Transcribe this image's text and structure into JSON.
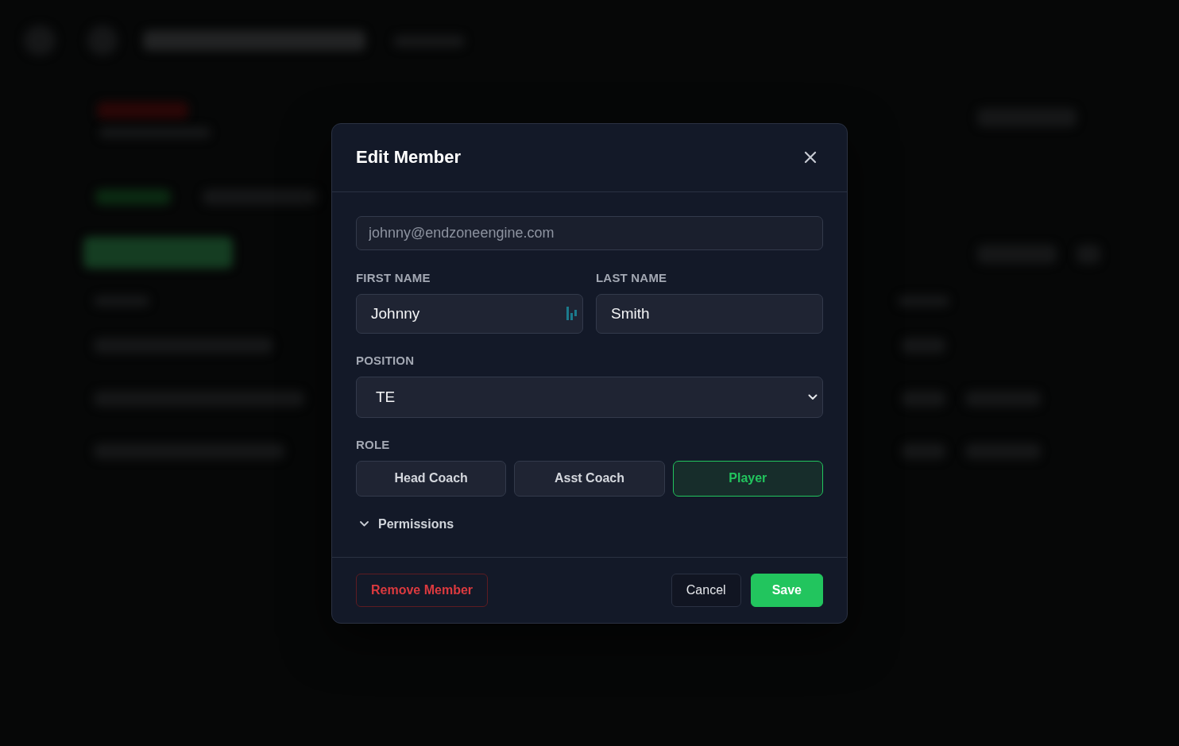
{
  "dialog": {
    "title": "Edit Member"
  },
  "email": {
    "value": "johnny@endzoneengine.com",
    "disabled": true
  },
  "name_fields": [
    {
      "label": "FIRST NAME",
      "value": "Johnny"
    },
    {
      "label": "LAST NAME",
      "value": "Smith"
    }
  ],
  "position": {
    "label": "POSITION",
    "value": "TE"
  },
  "role": {
    "label": "ROLE",
    "options": [
      {
        "label": "Head Coach",
        "selected": false
      },
      {
        "label": "Asst Coach",
        "selected": false
      },
      {
        "label": "Player",
        "selected": true
      }
    ]
  },
  "permissions": {
    "label": "Permissions"
  },
  "footer": {
    "buttons": [
      {
        "label": "Remove Member",
        "kind": "danger"
      },
      {
        "label": "Cancel",
        "kind": "secondary"
      },
      {
        "label": "Save",
        "kind": "primary"
      }
    ]
  }
}
